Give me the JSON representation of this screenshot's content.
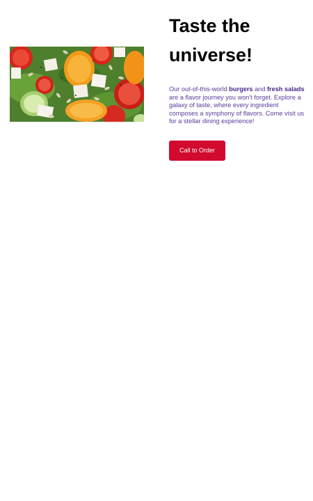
{
  "hero": {
    "image_icon": "salad-photo"
  },
  "headline": {
    "line1": "Taste the",
    "line2": "universe!"
  },
  "description": {
    "part1": "Our out-of-this-world ",
    "bold1": "burgers",
    "part2": " and ",
    "bold2": "fresh salads",
    "part3": " are a flavor journey you won't forget. Explore a galaxy of taste, where every ingredient composes a symphony of flavors. Come visit us for a stellar dining experience!"
  },
  "cta": {
    "label": "Call to Order",
    "color": "#d10a2e"
  },
  "colors": {
    "text_accent": "#5a3a9a",
    "heading": "#000000",
    "background": "#ffffff"
  }
}
